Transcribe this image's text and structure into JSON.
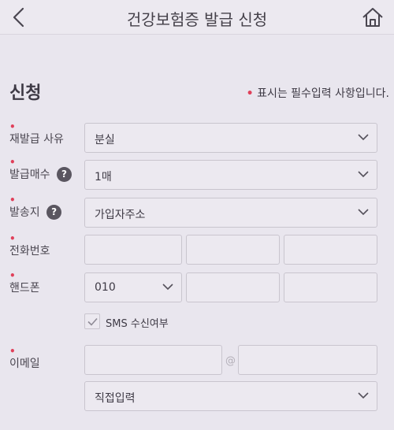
{
  "header": {
    "title": "건강보험증 발급 신청",
    "back_icon": "chevron-left-icon",
    "home_icon": "home-icon"
  },
  "section": {
    "title": "신청",
    "required_note_dot": "•",
    "required_note": "표시는 필수입력 사항입니다."
  },
  "form": {
    "reissue_reason": {
      "label": "재발급 사유",
      "value": "분실"
    },
    "issue_count": {
      "label": "발급매수",
      "help": "?",
      "value": "1매"
    },
    "send_location": {
      "label": "발송지",
      "help": "?",
      "value": "가입자주소"
    },
    "phone": {
      "label": "전화번호",
      "part1": "",
      "part2": "",
      "part3": ""
    },
    "mobile": {
      "label": "핸드폰",
      "prefix": "010",
      "part2": "",
      "part3": ""
    },
    "sms": {
      "label": "SMS 수신여부",
      "checked": true
    },
    "email": {
      "label": "이메일",
      "local": "",
      "at": "@",
      "domain": "",
      "domain_select": "직접입력"
    }
  },
  "colors": {
    "required_dot": "#e0405a",
    "background": "#e9e6ee"
  }
}
